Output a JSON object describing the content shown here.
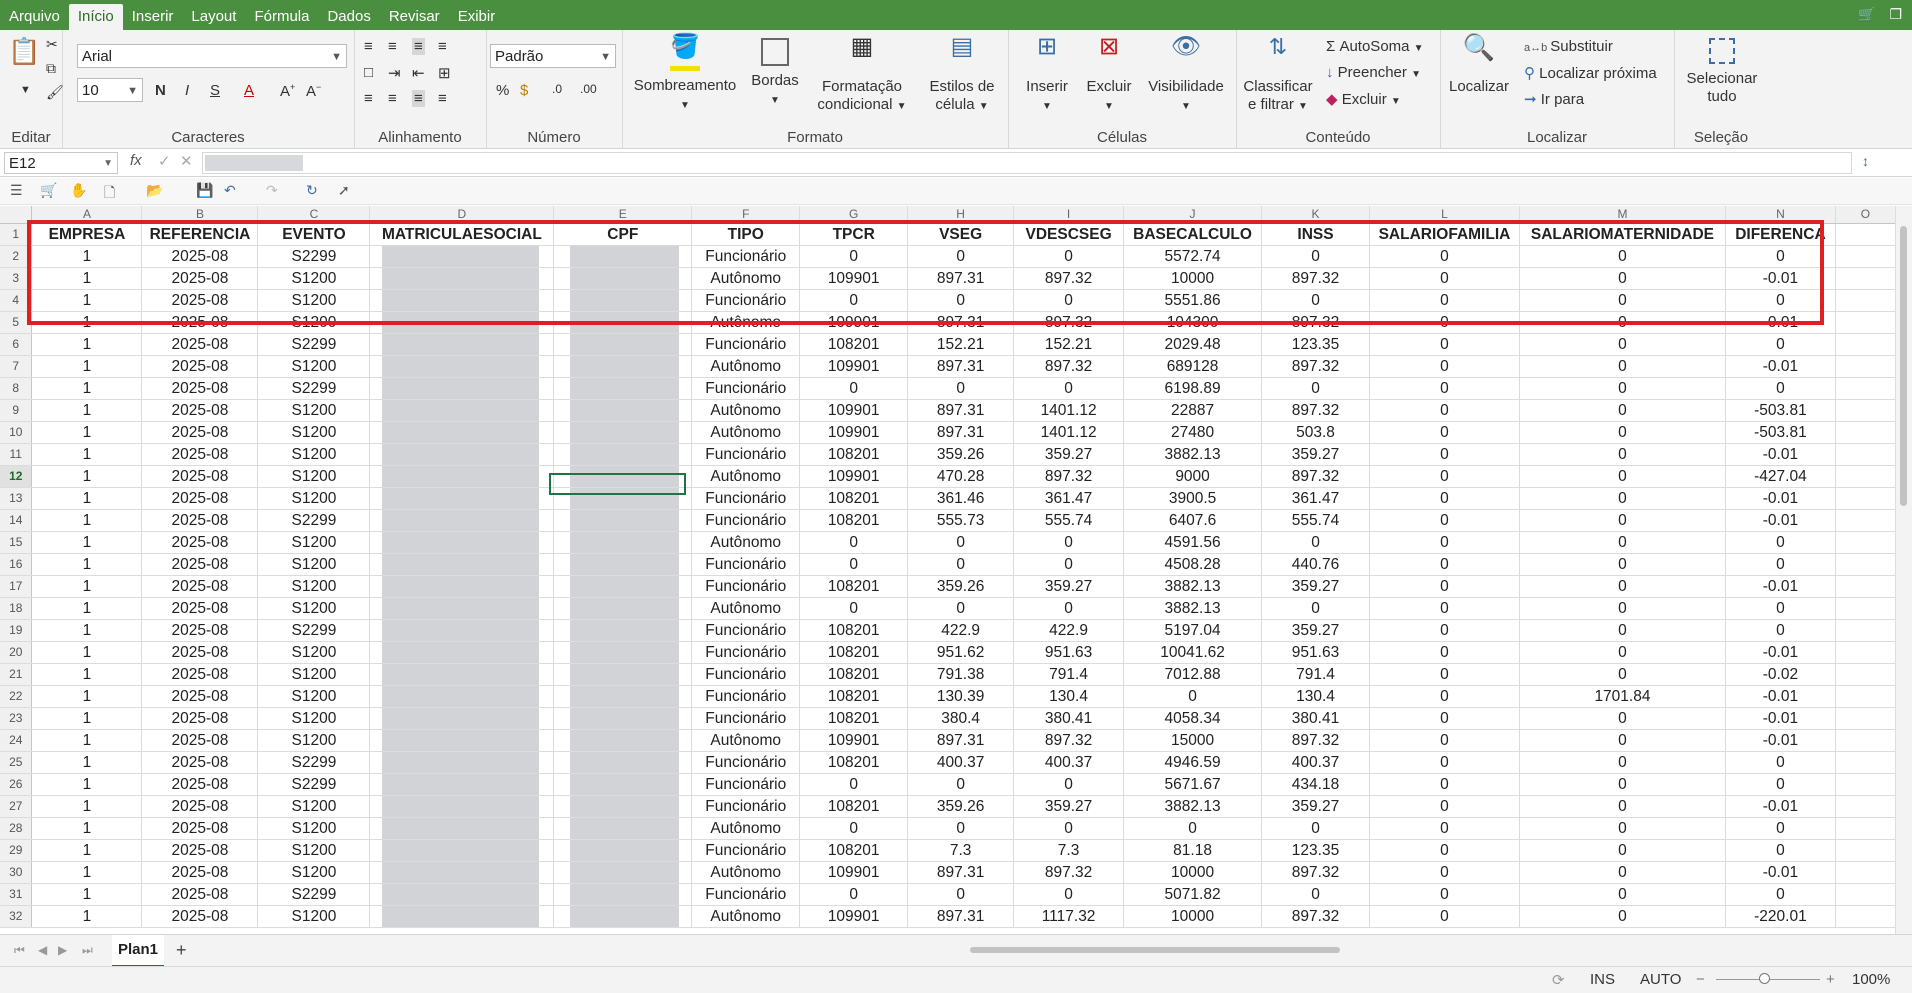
{
  "menu": {
    "items": [
      "Arquivo",
      "Início",
      "Inserir",
      "Layout",
      "Fórmula",
      "Dados",
      "Revisar",
      "Exibir"
    ],
    "active": "Início"
  },
  "ribbon": {
    "font_name": "Arial",
    "font_size": "10",
    "number_format": "Padrão",
    "groups": {
      "editar": "Editar",
      "caracteres": "Caracteres",
      "alinhamento": "Alinhamento",
      "numero": "Número",
      "formato": "Formato",
      "celulas": "Células",
      "conteudo": "Conteúdo",
      "localizar": "Localizar",
      "selecao": "Seleção"
    },
    "buttons": {
      "sombreamento": "Sombreamento",
      "bordas": "Bordas",
      "formatacao1": "Formatação",
      "formatacao2": "condicional",
      "estilos1": "Estilos de",
      "estilos2": "célula",
      "inserir": "Inserir",
      "excluir": "Excluir",
      "visibilidade": "Visibilidade",
      "classificar1": "Classificar",
      "classificar2": "e filtrar",
      "autosoma": "AutoSoma",
      "preencher": "Preencher",
      "excluir2": "Excluir",
      "localizar": "Localizar",
      "substituir": "Substituir",
      "localizar_proxima": "Localizar próxima",
      "ir_para": "Ir para",
      "selecionar1": "Selecionar",
      "selecionar2": "tudo"
    }
  },
  "formula_bar": {
    "name_box": "E12",
    "fx": "fx"
  },
  "sheet": {
    "columns": [
      "A",
      "B",
      "C",
      "D",
      "E",
      "F",
      "G",
      "H",
      "I",
      "J",
      "K",
      "L",
      "M",
      "N",
      "O"
    ],
    "headers": [
      "EMPRESA",
      "REFERENCIA",
      "EVENTO",
      "MATRICULAESOCIAL",
      "CPF",
      "TIPO",
      "TPCR",
      "VSEG",
      "VDESCSEG",
      "BASECALCULO",
      "INSS",
      "SALARIOFAMILIA",
      "SALARIOMATERNIDADE",
      "DIFERENCA"
    ],
    "rows": [
      [
        "1",
        "2025-08",
        "S2299",
        "Funcionário",
        "0",
        "0",
        "0",
        "5572.74",
        "0",
        "0",
        "0",
        "0"
      ],
      [
        "1",
        "2025-08",
        "S1200",
        "Autônomo",
        "109901",
        "897.31",
        "897.32",
        "10000",
        "897.32",
        "0",
        "0",
        "-0.01"
      ],
      [
        "1",
        "2025-08",
        "S1200",
        "Funcionário",
        "0",
        "0",
        "0",
        "5551.86",
        "0",
        "0",
        "0",
        "0"
      ],
      [
        "1",
        "2025-08",
        "S1200",
        "Autônomo",
        "109901",
        "897.31",
        "897.32",
        "104300",
        "897.32",
        "0",
        "0",
        "-0.01"
      ],
      [
        "1",
        "2025-08",
        "S2299",
        "Funcionário",
        "108201",
        "152.21",
        "152.21",
        "2029.48",
        "123.35",
        "0",
        "0",
        "0"
      ],
      [
        "1",
        "2025-08",
        "S1200",
        "Autônomo",
        "109901",
        "897.31",
        "897.32",
        "689128",
        "897.32",
        "0",
        "0",
        "-0.01"
      ],
      [
        "1",
        "2025-08",
        "S2299",
        "Funcionário",
        "0",
        "0",
        "0",
        "6198.89",
        "0",
        "0",
        "0",
        "0"
      ],
      [
        "1",
        "2025-08",
        "S1200",
        "Autônomo",
        "109901",
        "897.31",
        "1401.12",
        "22887",
        "897.32",
        "0",
        "0",
        "-503.81"
      ],
      [
        "1",
        "2025-08",
        "S1200",
        "Autônomo",
        "109901",
        "897.31",
        "1401.12",
        "27480",
        "503.8",
        "0",
        "0",
        "-503.81"
      ],
      [
        "1",
        "2025-08",
        "S1200",
        "Funcionário",
        "108201",
        "359.26",
        "359.27",
        "3882.13",
        "359.27",
        "0",
        "0",
        "-0.01"
      ],
      [
        "1",
        "2025-08",
        "S1200",
        "Autônomo",
        "109901",
        "470.28",
        "897.32",
        "9000",
        "897.32",
        "0",
        "0",
        "-427.04"
      ],
      [
        "1",
        "2025-08",
        "S1200",
        "Funcionário",
        "108201",
        "361.46",
        "361.47",
        "3900.5",
        "361.47",
        "0",
        "0",
        "-0.01"
      ],
      [
        "1",
        "2025-08",
        "S2299",
        "Funcionário",
        "108201",
        "555.73",
        "555.74",
        "6407.6",
        "555.74",
        "0",
        "0",
        "-0.01"
      ],
      [
        "1",
        "2025-08",
        "S1200",
        "Autônomo",
        "0",
        "0",
        "0",
        "4591.56",
        "0",
        "0",
        "0",
        "0"
      ],
      [
        "1",
        "2025-08",
        "S1200",
        "Funcionário",
        "0",
        "0",
        "0",
        "4508.28",
        "440.76",
        "0",
        "0",
        "0"
      ],
      [
        "1",
        "2025-08",
        "S1200",
        "Funcionário",
        "108201",
        "359.26",
        "359.27",
        "3882.13",
        "359.27",
        "0",
        "0",
        "-0.01"
      ],
      [
        "1",
        "2025-08",
        "S1200",
        "Autônomo",
        "0",
        "0",
        "0",
        "3882.13",
        "0",
        "0",
        "0",
        "0"
      ],
      [
        "1",
        "2025-08",
        "S2299",
        "Funcionário",
        "108201",
        "422.9",
        "422.9",
        "5197.04",
        "359.27",
        "0",
        "0",
        "0"
      ],
      [
        "1",
        "2025-08",
        "S1200",
        "Funcionário",
        "108201",
        "951.62",
        "951.63",
        "10041.62",
        "951.63",
        "0",
        "0",
        "-0.01"
      ],
      [
        "1",
        "2025-08",
        "S1200",
        "Funcionário",
        "108201",
        "791.38",
        "791.4",
        "7012.88",
        "791.4",
        "0",
        "0",
        "-0.02"
      ],
      [
        "1",
        "2025-08",
        "S1200",
        "Funcionário",
        "108201",
        "130.39",
        "130.4",
        "0",
        "130.4",
        "0",
        "1701.84",
        "-0.01"
      ],
      [
        "1",
        "2025-08",
        "S1200",
        "Funcionário",
        "108201",
        "380.4",
        "380.41",
        "4058.34",
        "380.41",
        "0",
        "0",
        "-0.01"
      ],
      [
        "1",
        "2025-08",
        "S1200",
        "Autônomo",
        "109901",
        "897.31",
        "897.32",
        "15000",
        "897.32",
        "0",
        "0",
        "-0.01"
      ],
      [
        "1",
        "2025-08",
        "S2299",
        "Funcionário",
        "108201",
        "400.37",
        "400.37",
        "4946.59",
        "400.37",
        "0",
        "0",
        "0"
      ],
      [
        "1",
        "2025-08",
        "S2299",
        "Funcionário",
        "0",
        "0",
        "0",
        "5671.67",
        "434.18",
        "0",
        "0",
        "0"
      ],
      [
        "1",
        "2025-08",
        "S1200",
        "Funcionário",
        "108201",
        "359.26",
        "359.27",
        "3882.13",
        "359.27",
        "0",
        "0",
        "-0.01"
      ],
      [
        "1",
        "2025-08",
        "S1200",
        "Autônomo",
        "0",
        "0",
        "0",
        "0",
        "0",
        "0",
        "0",
        "0"
      ],
      [
        "1",
        "2025-08",
        "S1200",
        "Funcionário",
        "108201",
        "7.3",
        "7.3",
        "81.18",
        "123.35",
        "0",
        "0",
        "0"
      ],
      [
        "1",
        "2025-08",
        "S1200",
        "Autônomo",
        "109901",
        "897.31",
        "897.32",
        "10000",
        "897.32",
        "0",
        "0",
        "-0.01"
      ],
      [
        "1",
        "2025-08",
        "S2299",
        "Funcionário",
        "0",
        "0",
        "0",
        "5071.82",
        "0",
        "0",
        "0",
        "0"
      ],
      [
        "1",
        "2025-08",
        "S1200",
        "Autônomo",
        "109901",
        "897.31",
        "1117.32",
        "10000",
        "897.32",
        "0",
        "0",
        "-220.01"
      ]
    ],
    "selected_row": "12",
    "tab_name": "Plan1"
  },
  "status_bar": {
    "ins": "INS",
    "auto": "AUTO",
    "zoom": "100%"
  },
  "colors": {
    "accent": "#217346",
    "menubar": "#4a8f3f",
    "highlight_box": "#e02020",
    "redacted": "#d1d3d6"
  }
}
